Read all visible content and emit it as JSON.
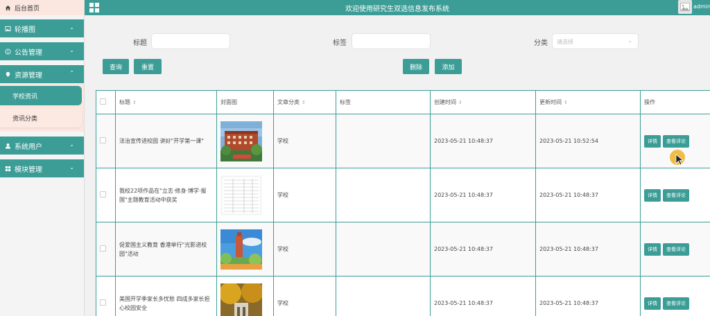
{
  "header": {
    "title": "欢迎使用研究生双选信息发布系统",
    "user": "admin",
    "menu_icon": "grid-icon",
    "avatar_icon": "image-icon"
  },
  "sidebar": {
    "home": {
      "label": "后台首页",
      "icon": "home-icon"
    },
    "items": [
      {
        "label": "轮播图",
        "icon": "picture-icon",
        "expanded": false
      },
      {
        "label": "公告管理",
        "icon": "info-icon",
        "expanded": false
      },
      {
        "label": "资源管理",
        "icon": "pin-icon",
        "expanded": true,
        "children": [
          {
            "label": "学校资讯",
            "active": true
          },
          {
            "label": "资讯分类",
            "active": false
          }
        ]
      },
      {
        "label": "系统用户",
        "icon": "user-icon",
        "expanded": false
      },
      {
        "label": "模块管理",
        "icon": "grid-icon",
        "expanded": false
      }
    ]
  },
  "filters": {
    "title_label": "标题",
    "title_value": "",
    "tag_label": "标签",
    "tag_value": "",
    "category_label": "分类",
    "category_placeholder": "请选择"
  },
  "buttons": {
    "query": "查询",
    "reset": "重置",
    "delete": "删除",
    "add": "添加"
  },
  "table": {
    "columns": [
      "标题",
      "封面图",
      "文章分类",
      "标签",
      "创建时间",
      "更新时间",
      "操作"
    ],
    "detail_label": "详情",
    "comments_label": "查看评论",
    "rows": [
      {
        "title": "法治宣传进校园 讲好\"开学第一课\"",
        "category": "学校",
        "tag": "",
        "created": "2023-05-21 10:48:37",
        "updated": "2023-05-21 10:52:54",
        "cover": "campus-building"
      },
      {
        "title": "我校22项作品在\"立志·修身·博学·报国\"主题教育活动中获奖",
        "category": "学校",
        "tag": "",
        "created": "2023-05-21 10:48:37",
        "updated": "2023-05-21 10:48:37",
        "cover": "document-scan"
      },
      {
        "title": "促爱国主义教育 香港举行\"光影进校园\"活动",
        "category": "学校",
        "tag": "",
        "created": "2023-05-21 10:48:37",
        "updated": "2023-05-21 10:48:37",
        "cover": "tower-sky"
      },
      {
        "title": "美国开学季家长多忧愁 四成多家长担心校园安全",
        "category": "学校",
        "tag": "",
        "created": "2023-05-21 10:48:37",
        "updated": "2023-05-21 10:48:37",
        "cover": "autumn-campus"
      }
    ]
  },
  "colors": {
    "primary": "#3b9d96",
    "sidebar_pink": "#fbe6e0",
    "cursor": "#f0b028"
  }
}
